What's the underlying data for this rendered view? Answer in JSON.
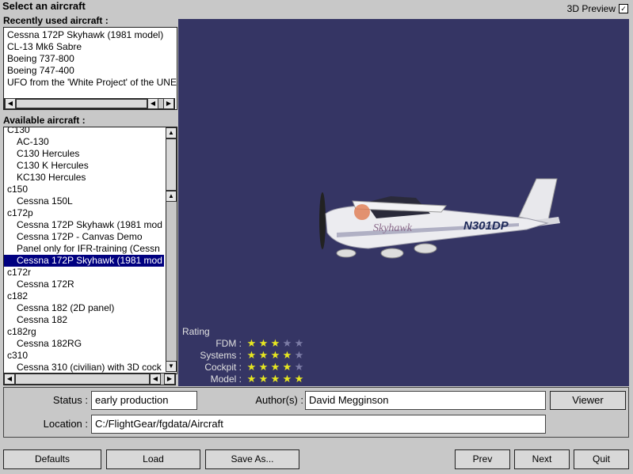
{
  "window": {
    "title": "Select an aircraft"
  },
  "preview_toggle": {
    "label": "3D Preview",
    "checked": "✓"
  },
  "recent": {
    "label": "Recently used aircraft :",
    "items": [
      "Cessna 172P Skyhawk (1981 model)",
      "CL-13 Mk6 Sabre",
      "Boeing 737-800",
      "Boeing 747-400",
      "UFO from the 'White Project' of the UNE"
    ]
  },
  "available": {
    "label": "Available aircraft :",
    "items": [
      {
        "text": "C130",
        "child": false,
        "selected": false
      },
      {
        "text": "AC-130",
        "child": true,
        "selected": false
      },
      {
        "text": "C130 Hercules",
        "child": true,
        "selected": false
      },
      {
        "text": "C130 K Hercules",
        "child": true,
        "selected": false
      },
      {
        "text": "KC130 Hercules",
        "child": true,
        "selected": false
      },
      {
        "text": "c150",
        "child": false,
        "selected": false
      },
      {
        "text": "Cessna 150L",
        "child": true,
        "selected": false
      },
      {
        "text": "c172p",
        "child": false,
        "selected": false
      },
      {
        "text": "Cessna 172P Skyhawk (1981 mod",
        "child": true,
        "selected": false
      },
      {
        "text": "Cessna 172P - Canvas Demo",
        "child": true,
        "selected": false
      },
      {
        "text": "Panel only for IFR-training (Cessn",
        "child": true,
        "selected": false
      },
      {
        "text": "Cessna 172P Skyhawk (1981 mod",
        "child": true,
        "selected": true
      },
      {
        "text": "c172r",
        "child": false,
        "selected": false
      },
      {
        "text": "Cessna 172R",
        "child": true,
        "selected": false
      },
      {
        "text": "c182",
        "child": false,
        "selected": false
      },
      {
        "text": "Cessna 182 (2D panel)",
        "child": true,
        "selected": false
      },
      {
        "text": "Cessna 182",
        "child": true,
        "selected": false
      },
      {
        "text": "c182rg",
        "child": false,
        "selected": false
      },
      {
        "text": "Cessna 182RG",
        "child": true,
        "selected": false
      },
      {
        "text": "c310",
        "child": false,
        "selected": false
      },
      {
        "text": "Cessna 310 (civilian) with 3D cock",
        "child": true,
        "selected": false
      }
    ]
  },
  "aircraft_model": {
    "registration": "N301DP",
    "brand": "Skyhawk"
  },
  "rating": {
    "heading": "Rating",
    "rows": [
      {
        "label": "FDM :",
        "value": 3,
        "max": 5
      },
      {
        "label": "Systems :",
        "value": 4,
        "max": 5
      },
      {
        "label": "Cockpit :",
        "value": 4,
        "max": 5
      },
      {
        "label": "Model :",
        "value": 5,
        "max": 5
      }
    ]
  },
  "details": {
    "status_label": "Status :",
    "status_value": "early production",
    "author_label": "Author(s) :",
    "author_value": "David Megginson",
    "viewer_label": "Viewer",
    "location_label": "Location :",
    "location_value": "C:/FlightGear/fgdata/Aircraft"
  },
  "buttons": {
    "defaults": "Defaults",
    "load": "Load",
    "save_as": "Save As...",
    "prev": "Prev",
    "next": "Next",
    "quit": "Quit"
  },
  "colors": {
    "background": "#c8c8c8",
    "preview_bg": "#353564",
    "selection": "#000080",
    "star_on": "#e8e820"
  }
}
